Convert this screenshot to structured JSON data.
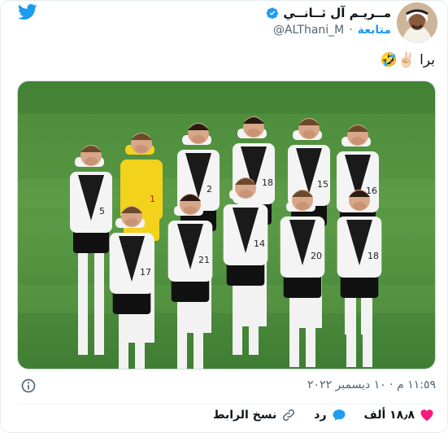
{
  "header": {
    "display_name": "مــريـم آل ثــانــي",
    "handle": "@ALThani_M",
    "separator": "·",
    "follow_label": "متابعة"
  },
  "tweet": {
    "text": "برا",
    "emojis": "✌🏻🤣"
  },
  "photo": {
    "jersey_numbers": [
      "1",
      "2",
      "15",
      "5",
      "18",
      "16",
      "17",
      "21",
      "14",
      "20"
    ]
  },
  "meta": {
    "timestamp": "١١:٥٩ م · ١٠ ديسمبر ٢٠٢٢"
  },
  "actions": {
    "like_count": "١٨٫٨ ألف",
    "reply_label": "رد",
    "copy_link_label": "نسخ الرابط"
  },
  "colors": {
    "twitter_blue": "#1d9bf0",
    "like_pink": "#f91880",
    "verified_blue": "#1d9bf0",
    "pitch_green": "#4f8f3d"
  }
}
